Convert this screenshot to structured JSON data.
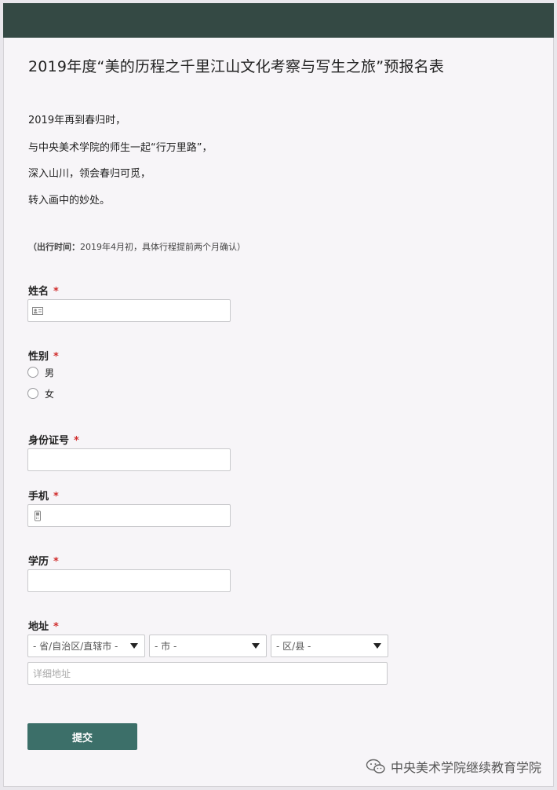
{
  "form": {
    "title": "2019年度“美的历程之千里江山文化考察与写生之旅”预报名表",
    "intro": [
      "2019年再到春归时，",
      "与中央美术学院的师生一起“行万里路”，",
      "深入山川，领会春归可觅，",
      "转入画中的妙处。"
    ],
    "note_label": "（出行时间：",
    "note_text": "2019年4月初，具体行程提前两个月确认）",
    "required_mark": "*",
    "fields": {
      "name": {
        "label": "姓名",
        "value": "",
        "icon": "id-card-icon"
      },
      "gender": {
        "label": "性别",
        "options": [
          "男",
          "女"
        ]
      },
      "id_number": {
        "label": "身份证号",
        "value": ""
      },
      "phone": {
        "label": "手机",
        "value": "",
        "icon": "mobile-phone-icon"
      },
      "education": {
        "label": "学历",
        "value": ""
      },
      "address": {
        "label": "地址",
        "province": "- 省/自治区/直辖市 -",
        "city": "- 市 -",
        "district": "- 区/县 -",
        "detail_placeholder": "详细地址"
      }
    },
    "submit_label": "提交"
  },
  "watermark": {
    "text": "中央美术学院继续教育学院",
    "icon": "wechat-icon"
  },
  "colors": {
    "header_bar": "#344944",
    "submit_button": "#3c6f69",
    "required": "#d02c2c",
    "background": "#f7f5f8"
  }
}
